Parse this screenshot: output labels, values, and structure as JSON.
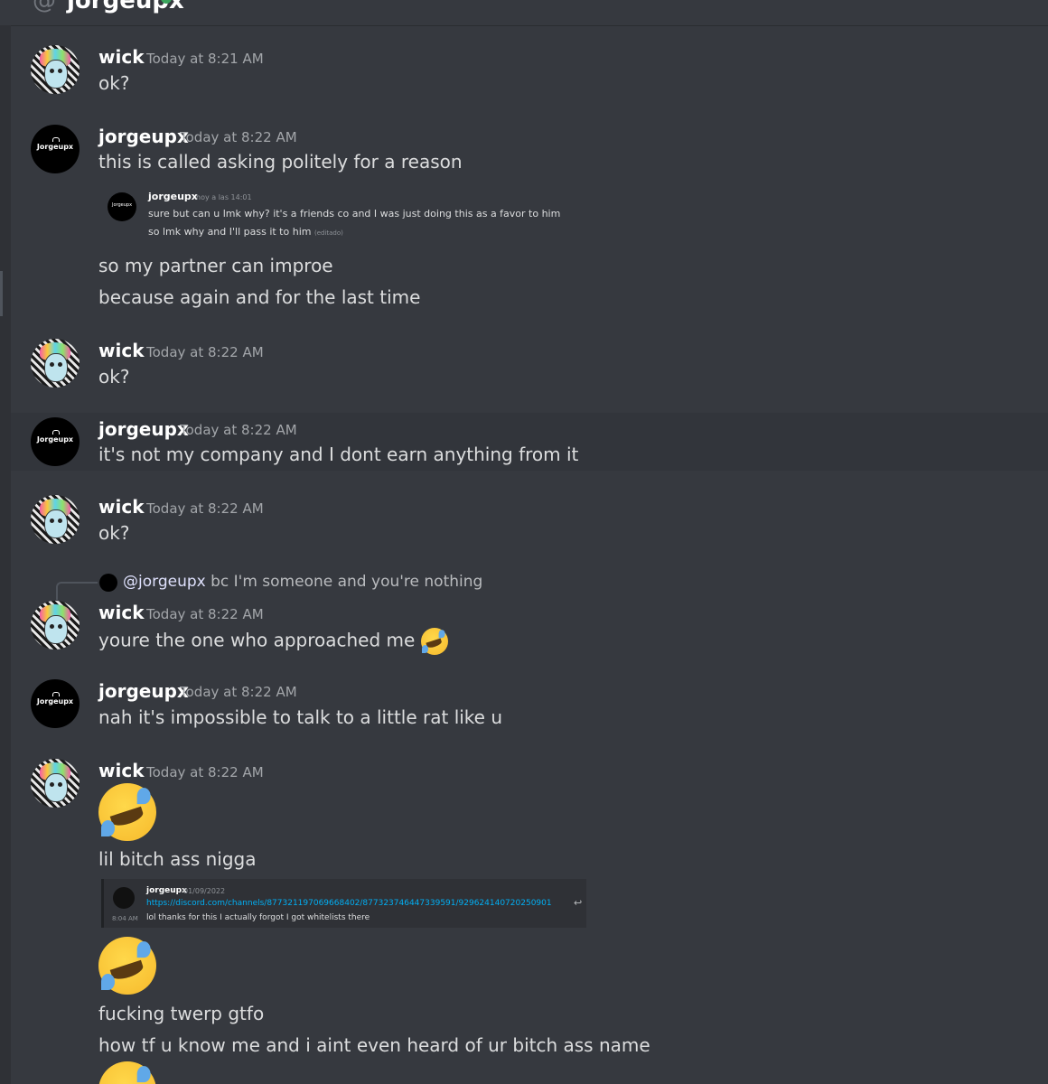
{
  "header": {
    "at_symbol": "@",
    "title": "jorgeupx"
  },
  "users": {
    "wick": {
      "name": "wick"
    },
    "jorgeupx": {
      "name": "jorgeupx",
      "avatar_text": "Jorgeupx"
    }
  },
  "messages": [
    {
      "author": "wick",
      "time": "Today at 8:21 AM",
      "lines": [
        "ok?"
      ]
    },
    {
      "author": "jorgeupx",
      "time": "Today at 8:22 AM",
      "lines": [
        "this is called asking politely for a reason",
        "so my partner can improe",
        "because again and for the last time"
      ]
    },
    {
      "author": "wick",
      "time": "Today at 8:22 AM",
      "lines": [
        "ok?"
      ]
    },
    {
      "author": "jorgeupx",
      "time": "Today at 8:22 AM",
      "lines": [
        "it's not my company and I dont earn anything from it"
      ]
    },
    {
      "author": "wick",
      "time": "Today at 8:22 AM",
      "lines": [
        "ok?"
      ]
    },
    {
      "author": "wick",
      "time": "Today at 8:22 AM",
      "lines": [
        "youre the one who approached me"
      ]
    },
    {
      "author": "jorgeupx",
      "time": "Today at 8:22 AM",
      "lines": [
        "nah it's impossible to talk to a little rat like u"
      ]
    },
    {
      "author": "wick",
      "time": "Today at 8:22 AM",
      "lines": [
        "lil bitch ass nigga",
        "fucking twerp gtfo",
        "how tf u know me and i aint even heard of ur bitch ass name"
      ]
    }
  ],
  "embedded_quote": {
    "name": "jorgeupx",
    "time": "hoy a las 14:01",
    "line1": "sure but can u lmk why? it's a friends co and I was just doing this as a favor to him",
    "line2": "so lmk why and I'll pass it to him",
    "edited": "(editado)"
  },
  "reply": {
    "mention": "@jorgeupx",
    "text": "bc I'm someone and you're nothing"
  },
  "embedded_quote_2": {
    "name": "jorgeupx",
    "date": "01/09/2022",
    "link": "https://discord.com/channels/877321197069668402/877323746447339591/929624140720250901",
    "time": "8:04 AM",
    "text": "lol thanks for this I actually forgot I got whitelists there"
  },
  "emoji": {
    "name": "rofl-emoji"
  }
}
